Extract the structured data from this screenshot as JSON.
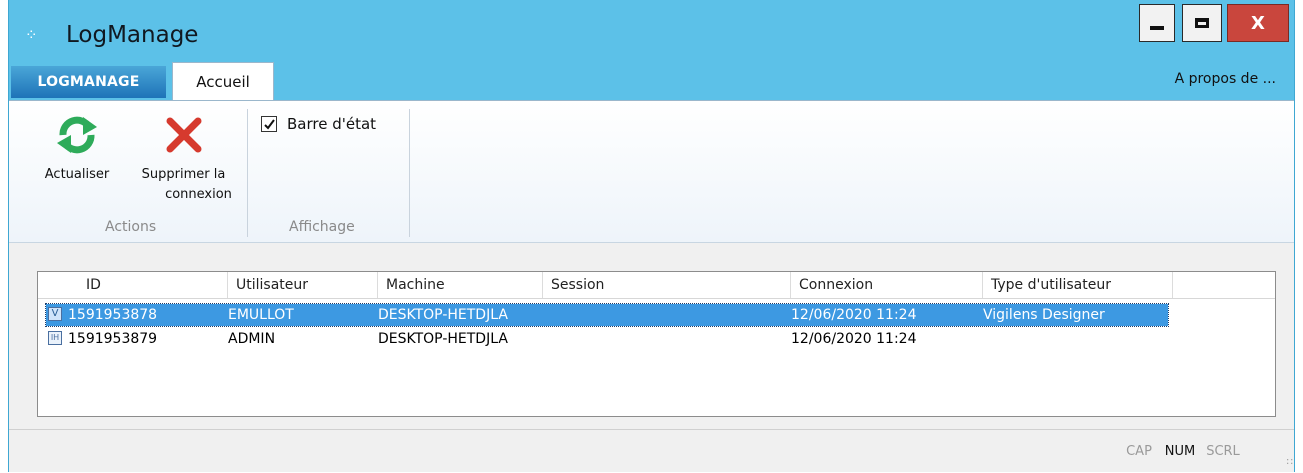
{
  "window": {
    "title": "LogManage",
    "controls": {
      "minimize": "minimize",
      "maximize": "maximize",
      "close": "X"
    }
  },
  "tabs": {
    "app_tab": "LOGMANAGE",
    "home_tab": "Accueil",
    "about": "A propos de ..."
  },
  "ribbon": {
    "refresh_label": "Actualiser",
    "delete_label_line1": "Supprimer la",
    "delete_label_line2": "connexion",
    "actions_group": "Actions",
    "statusbar_checkbox": "Barre d'état",
    "statusbar_checked": true,
    "display_group": "Affichage"
  },
  "table": {
    "columns": [
      "ID",
      "Utilisateur",
      "Machine",
      "Session",
      "Connexion",
      "Type d'utilisateur"
    ],
    "rows": [
      {
        "icon": "V",
        "id": "1591953878",
        "user": "EMULLOT",
        "machine": "DESKTOP-HETDJLA",
        "session": "",
        "connexion": "12/06/2020 11:24",
        "type": "Vigilens Designer",
        "selected": true
      },
      {
        "icon": "IH",
        "id": "1591953879",
        "user": "ADMIN",
        "machine": "DESKTOP-HETDJLA",
        "session": "",
        "connexion": "12/06/2020 11:24",
        "type": "",
        "selected": false
      }
    ]
  },
  "status": {
    "cap": "CAP",
    "num": "NUM",
    "scrl": "SCRL"
  },
  "colors": {
    "window_frame": "#5cc1e8",
    "selection": "#3d99e2",
    "refresh_icon": "#2eab5a",
    "delete_icon": "#d63a2e",
    "close_button": "#c9463d"
  }
}
